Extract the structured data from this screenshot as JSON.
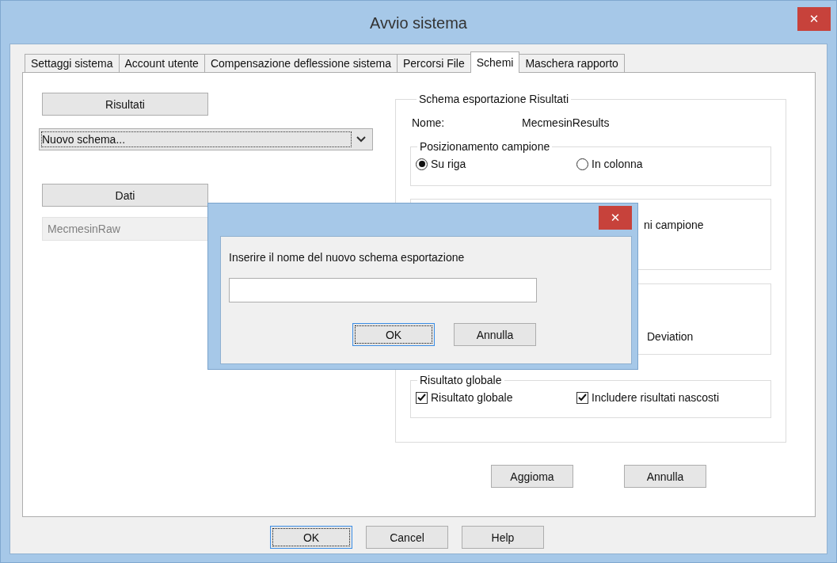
{
  "window": {
    "title": "Avvio sistema",
    "close": "✕"
  },
  "tabs": [
    {
      "label": "Settaggi sistema",
      "selected": false
    },
    {
      "label": "Account utente",
      "selected": false
    },
    {
      "label": "Compensazione deflessione sistema",
      "selected": false
    },
    {
      "label": "Percorsi File",
      "selected": false
    },
    {
      "label": "Schemi",
      "selected": true
    },
    {
      "label": "Maschera rapporto",
      "selected": false
    }
  ],
  "left": {
    "results_button": "Risultati",
    "scheme_select": "Nuovo schema...",
    "data_button": "Dati",
    "data_list": [
      {
        "label": "MecmesinRaw",
        "selected": false
      }
    ]
  },
  "export_scheme": {
    "title": "Schema esportazione Risultati",
    "name_label": "Nome:",
    "name_value": "MecmesinResults",
    "positioning": {
      "title": "Posizionamento campione",
      "options": [
        {
          "label": "Su riga",
          "selected": true
        },
        {
          "label": "In colonna",
          "selected": false
        }
      ]
    },
    "group_2_text": "ni campione",
    "group_3_text": "Deviation",
    "global_result": {
      "title": "Risultato globale",
      "checkboxes": [
        {
          "label": "Risultato globale",
          "checked": true
        },
        {
          "label": "Includere risultati nascosti",
          "checked": true
        }
      ]
    },
    "buttons": [
      "Aggioma",
      "Annulla"
    ]
  },
  "footer_buttons": [
    {
      "label": "OK",
      "default": true
    },
    {
      "label": "Cancel",
      "default": false
    },
    {
      "label": "Help",
      "default": false
    }
  ],
  "dialog": {
    "close": "✕",
    "prompt": "Inserire il nome del nuovo schema esportazione",
    "buttons": [
      {
        "label": "OK",
        "default": true
      },
      {
        "label": "Annulla",
        "default": false
      }
    ]
  }
}
